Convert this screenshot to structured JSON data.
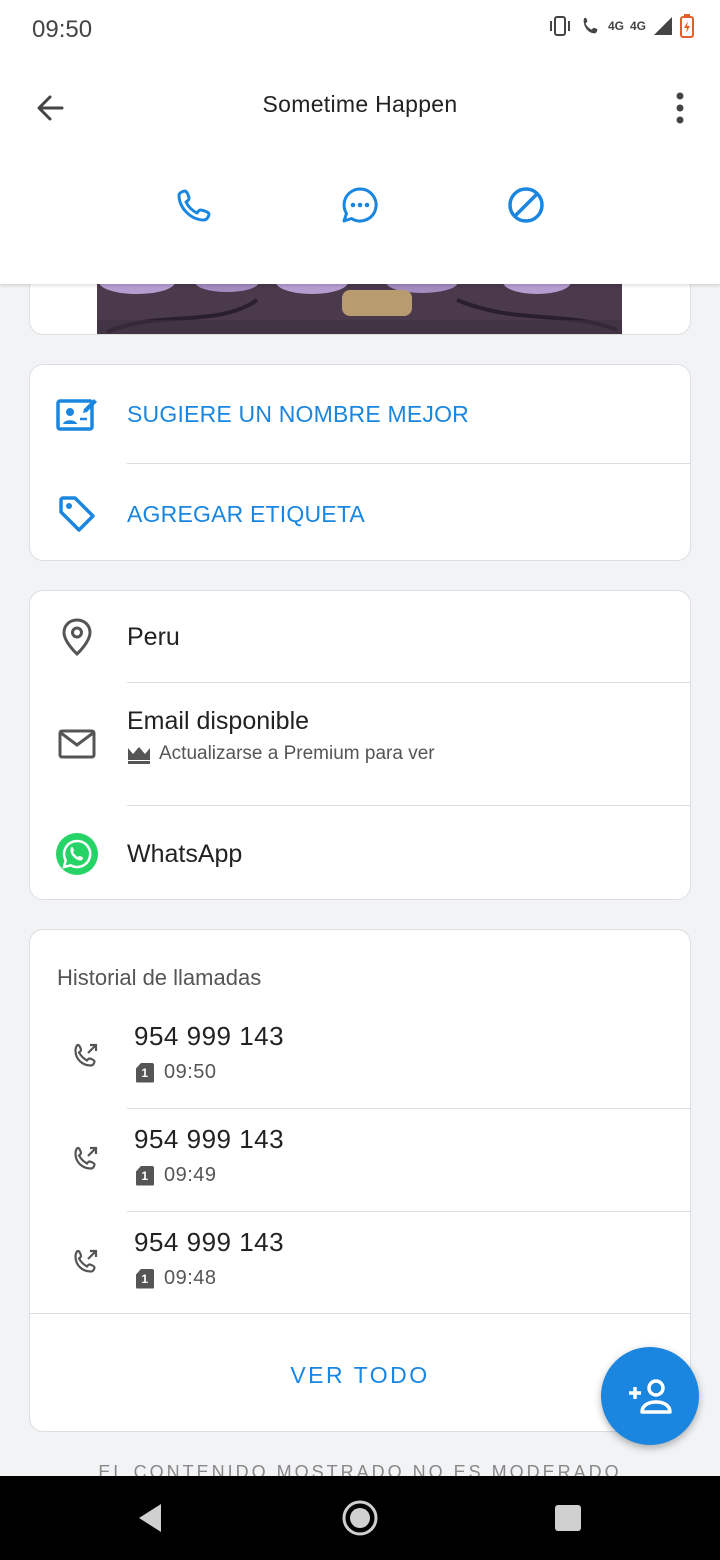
{
  "status_bar": {
    "time": "09:50",
    "network_1": "4G",
    "network_2": "4G"
  },
  "header": {
    "title": "Sometime Happen"
  },
  "actions": {
    "call": "call-icon",
    "message": "message-icon",
    "block": "block-icon"
  },
  "suggestions": {
    "suggest_name": "SUGIERE UN NOMBRE MEJOR",
    "add_tag": "AGREGAR ETIQUETA"
  },
  "info": {
    "location": "Peru",
    "email_title": "Email disponible",
    "email_subtitle": "Actualizarse a Premium para ver",
    "whatsapp": "WhatsApp"
  },
  "history": {
    "title": "Historial de llamadas",
    "calls": [
      {
        "number": "954 999 143",
        "sim": "1",
        "time": "09:50"
      },
      {
        "number": "954 999 143",
        "sim": "1",
        "time": "09:49"
      },
      {
        "number": "954 999 143",
        "sim": "1",
        "time": "09:48"
      }
    ],
    "see_all": "VER TODO"
  },
  "footer": {
    "note": "EL CONTENIDO MOSTRADO NO ES MODERADO"
  },
  "colors": {
    "accent": "#1a86e0",
    "whatsapp": "#25d366",
    "text": "#222222",
    "muted": "#555555"
  }
}
